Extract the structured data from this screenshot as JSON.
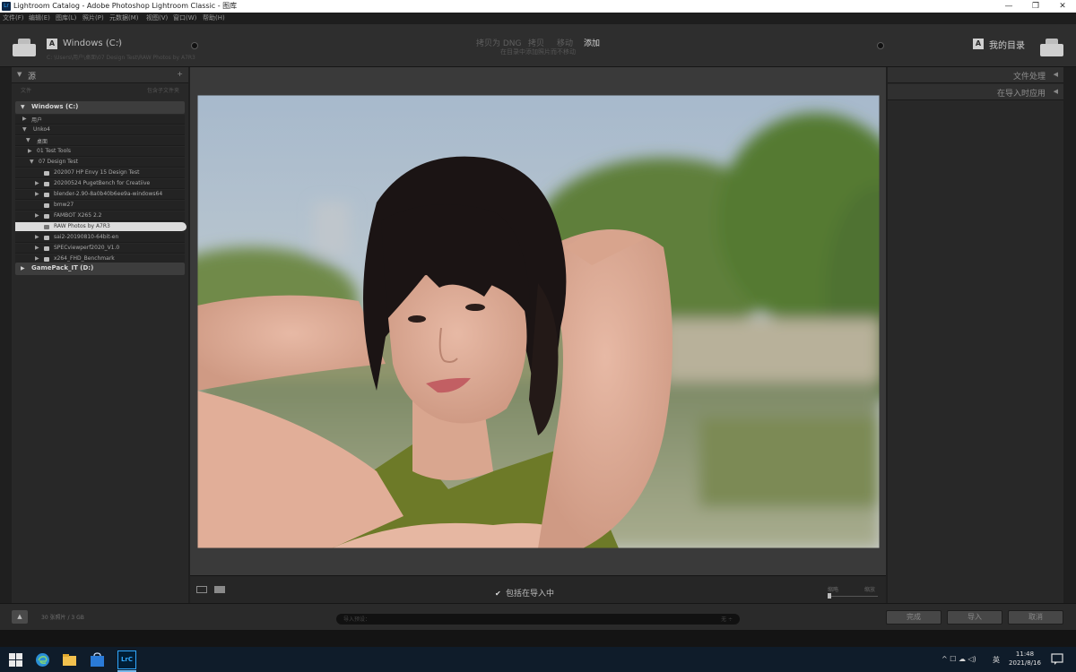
{
  "window": {
    "title": "Lightroom Catalog - Adobe Photoshop Lightroom Classic - 图库",
    "minimize": "—",
    "restore": "❐",
    "close": "✕"
  },
  "menu": [
    "文件(F)",
    "编辑(E)",
    "图库(L)",
    "照片(P)",
    "元数据(M)",
    "视图(V)",
    "窗口(W)",
    "帮助(H)"
  ],
  "header": {
    "source_badge": "A",
    "source_title": "Windows (C:)",
    "source_caret": "÷",
    "source_path": "C: \\Users\\用户\\桌面\\07 Design Test\\RAW Photos by A7R3",
    "modes": [
      "拷贝为 DNG",
      "拷贝",
      "移动",
      "添加"
    ],
    "mode_subtitle": "在目录中添加照片而不移动",
    "dest_badge": "A",
    "dest_title": "我的目录"
  },
  "source_panel": {
    "title": "源",
    "plus": "+",
    "filter_left": "文件",
    "filter_right": "包含子文件夹",
    "volumes": [
      "Windows (C:)",
      "GamePack_IT (D:)"
    ],
    "tree": [
      {
        "name": "用户",
        "arrow": "▶"
      },
      {
        "name": "Unko4",
        "arrow": "▼"
      },
      {
        "name": "桌面",
        "arrow": "▼"
      },
      {
        "name": "01 Test Tools",
        "arrow": "▶"
      },
      {
        "name": "07 Design Test",
        "arrow": "▼"
      },
      {
        "name": "202007 HP Envy 15 Design Test",
        "arrow": ""
      },
      {
        "name": "20200524 PugetBench for Creatiive",
        "arrow": "▶"
      },
      {
        "name": "blender-2.90-8a0b40b6ee9a-windows64",
        "arrow": "▶"
      },
      {
        "name": "bmw27",
        "arrow": ""
      },
      {
        "name": "FAMBOT X265 2.2",
        "arrow": "▶"
      },
      {
        "name": "RAW Photos by A7R3",
        "arrow": ""
      },
      {
        "name": "sai2-20190810-64bit-en",
        "arrow": "▶"
      },
      {
        "name": "SPECviewperf2020_V1.0",
        "arrow": "▶"
      },
      {
        "name": "x264_FHD_Benchmark",
        "arrow": "▶"
      }
    ]
  },
  "preview": {
    "include_label": "包括在导入中",
    "include_check": "✔",
    "sort_left": "缩略",
    "sort_right": "缩放"
  },
  "right_panel": {
    "sections": [
      "文件处理",
      "在导入时应用"
    ],
    "collapse": "◀"
  },
  "bottom": {
    "collapse": "▲",
    "count_text": "30 张照片 / 3 GB",
    "preset_label": "导入预设：",
    "preset_value": "无 ÷",
    "buttons": [
      "完成",
      "导入",
      "取消"
    ]
  },
  "taskbar": {
    "lang": "英",
    "tray_icons": "^ ☐ ☁ ◁)",
    "time": "11:48",
    "date": "2021/8/16",
    "lrc_label": "LrC"
  },
  "colors": {
    "lightroom_blue": "#31a8ff",
    "panel_bg": "#282828",
    "preview_bg": "#3a3a3a",
    "taskbar_bg": "#0f1c2a"
  }
}
